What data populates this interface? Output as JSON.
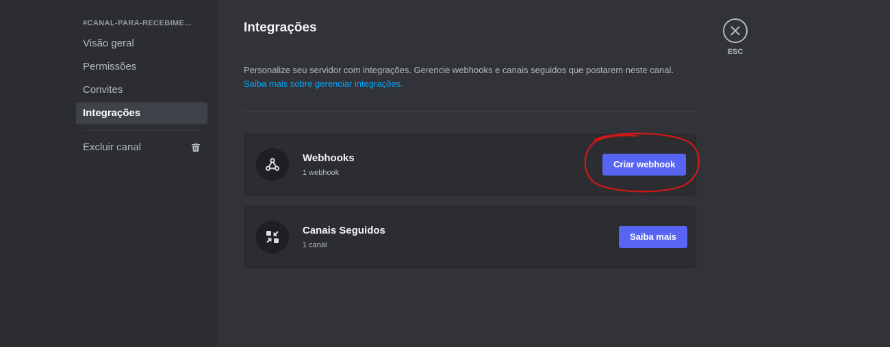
{
  "sidebar": {
    "channel_header": "#CANAL-PARA-RECEBIME...",
    "items": [
      {
        "label": "Visão geral"
      },
      {
        "label": "Permissões"
      },
      {
        "label": "Convites"
      },
      {
        "label": "Integrações"
      }
    ],
    "delete_label": "Excluir canal"
  },
  "main": {
    "title": "Integrações",
    "description": "Personalize seu servidor com integrações. Gerencie webhooks e canais seguidos que postarem neste canal.",
    "learn_more_link": "Saiba mais sobre gerenciar integrações.",
    "cards": [
      {
        "title": "Webhooks",
        "subtitle": "1 webhook",
        "button": "Criar webhook",
        "icon": "webhook-icon"
      },
      {
        "title": "Canais Seguidos",
        "subtitle": "1 canal",
        "button": "Saiba mais",
        "icon": "followed-channels-icon"
      }
    ]
  },
  "close": {
    "label": "ESC",
    "icon": "close-icon"
  },
  "colors": {
    "accent": "#5865f2",
    "link": "#00a8fc",
    "annotation": "#d01818"
  }
}
